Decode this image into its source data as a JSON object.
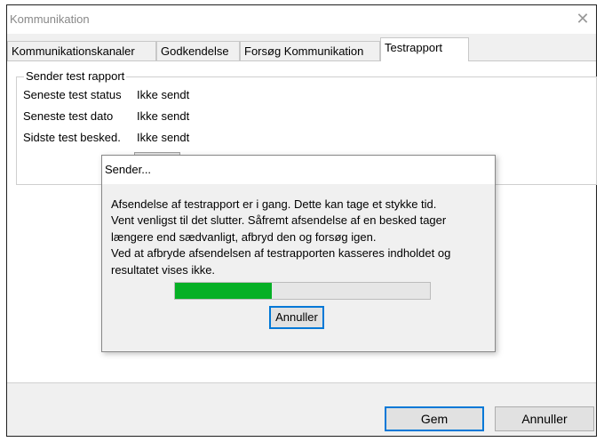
{
  "window": {
    "title": "Kommunikation",
    "close_glyph": "✕"
  },
  "tabs": [
    {
      "label": "Kommunikationskanaler",
      "active": false
    },
    {
      "label": "Godkendelse",
      "active": false
    },
    {
      "label": "Forsøg Kommunikation",
      "active": false
    },
    {
      "label": "Testrapport",
      "active": true
    }
  ],
  "group": {
    "legend": "Sender test rapport",
    "rows": [
      {
        "label": "Seneste test status",
        "value": "Ikke sendt"
      },
      {
        "label": "Seneste test dato",
        "value": "Ikke sendt"
      },
      {
        "label": "Sidste test besked.",
        "value": "Ikke sendt"
      }
    ]
  },
  "footer": {
    "save_label": "Gem",
    "cancel_label": "Annuller"
  },
  "dialog": {
    "title": "Sender...",
    "message_lines": [
      "Afsendelse af testrapport er i gang. Dette kan tage et stykke tid.",
      "Vent venligst til det slutter. Såfremt afsendelse af en besked tager",
      "længere end sædvanligt, afbryd den og forsøg igen.",
      "Ved at afbryde afsendelsen af testrapporten kasseres indholdet og",
      "resultatet vises ikke."
    ],
    "progress_percent": 38,
    "cancel_label": "Annuller"
  },
  "colors": {
    "progress_fill": "#06b025",
    "focus_border": "#0078d7"
  }
}
